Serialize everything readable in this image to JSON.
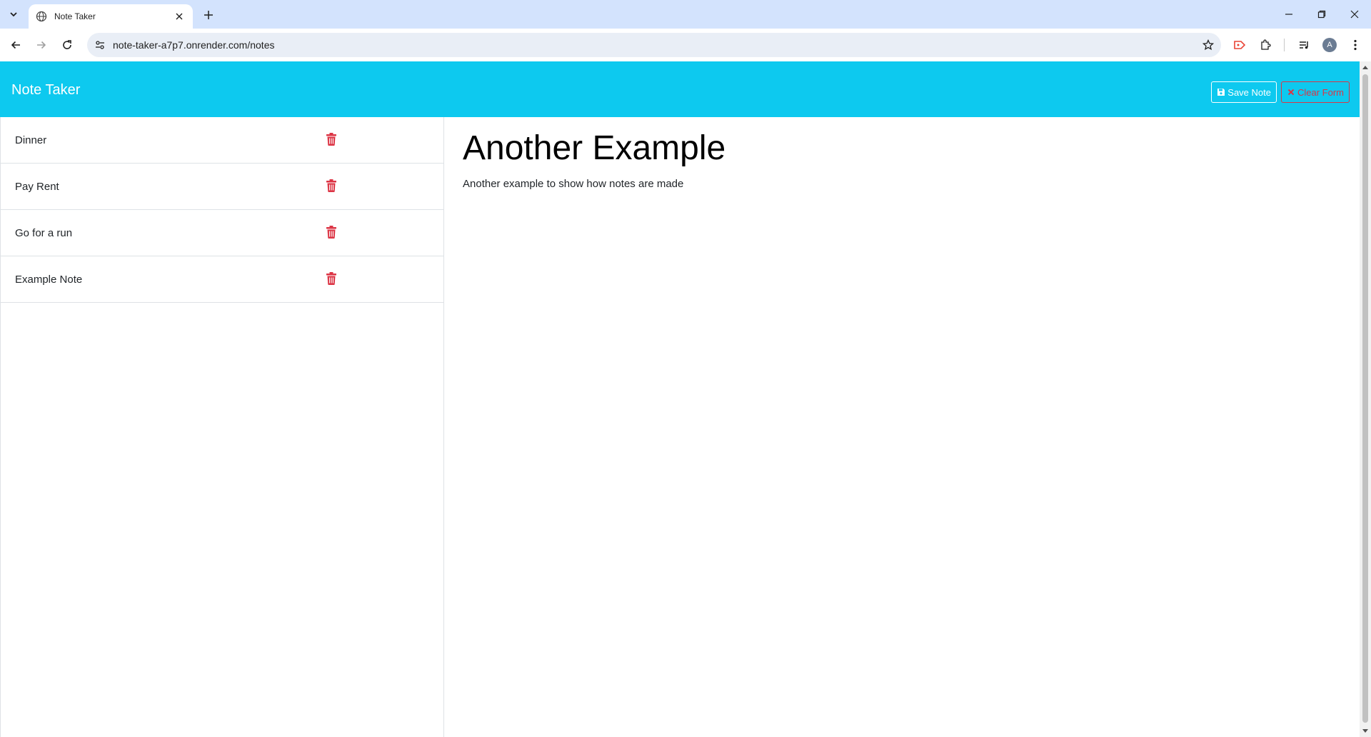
{
  "browser": {
    "tab_title": "Note Taker",
    "url": "note-taker-a7p7.onrender.com/notes",
    "profile_initial": "A"
  },
  "app": {
    "brand": "Note Taker",
    "save_label": "Save Note",
    "clear_label": "Clear Form",
    "accent_color": "#0dc9ef",
    "danger_color": "#dc3545"
  },
  "notes": [
    {
      "title": "Dinner"
    },
    {
      "title": "Pay Rent"
    },
    {
      "title": "Go for a run"
    },
    {
      "title": "Example Note"
    }
  ],
  "active_note": {
    "title": "Another Example",
    "text": "Another example to show how notes are made"
  }
}
